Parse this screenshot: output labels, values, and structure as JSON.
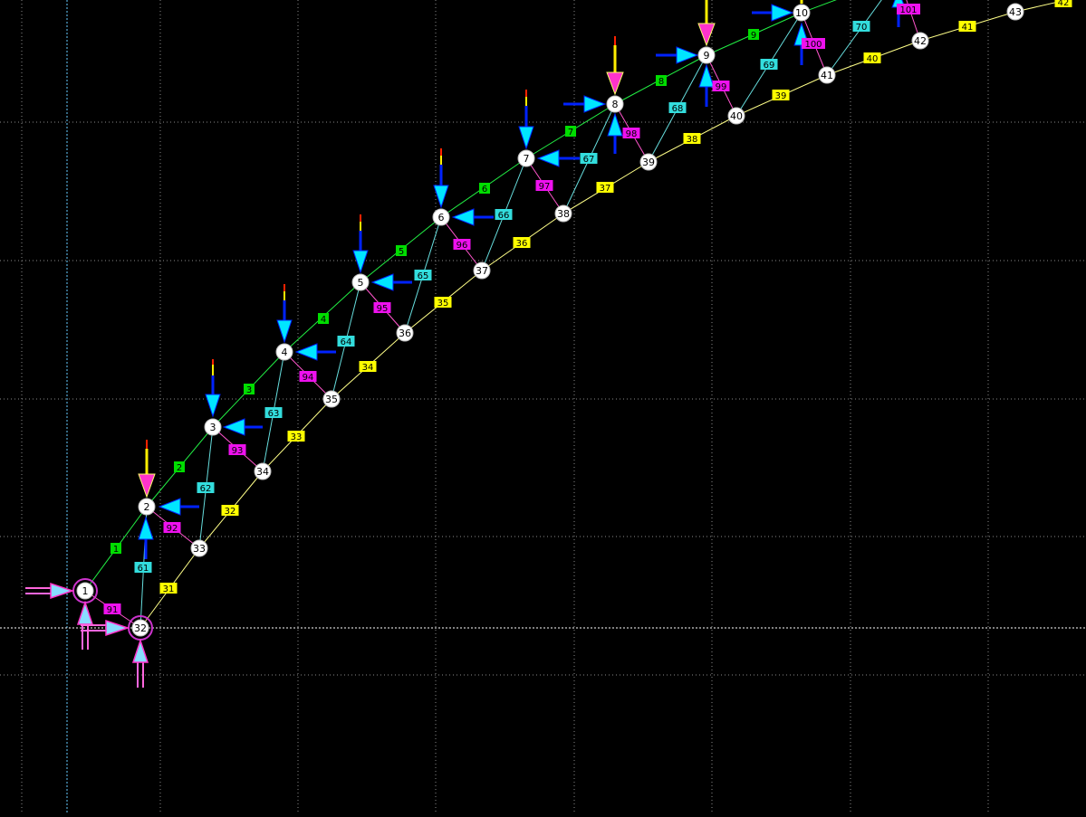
{
  "colors": {
    "background": "#000000",
    "grid": "#9a9a9a",
    "axis_dotted": "#ffffff",
    "axis_dashed_v": "#66ccff",
    "top_chord": "#00ff33",
    "bottom_chord": "#ffff66",
    "web_even": "#66e0e0",
    "web_odd": "#ff66cc",
    "node_fill": "#ffffff",
    "node_text": "#000000",
    "support_ring": "#cc33cc",
    "load_arrow": "#00e5ff",
    "load_shaft": "#0022ff",
    "load_magenta": "#ff33cc",
    "label_green": "#00dd00",
    "label_yellow": "#ffff00",
    "label_cyan": "#33dddd",
    "label_magenta": "#ee11ee"
  },
  "nodes": [
    {
      "id": "1"
    },
    {
      "id": "2"
    },
    {
      "id": "3"
    },
    {
      "id": "4"
    },
    {
      "id": "5"
    },
    {
      "id": "6"
    },
    {
      "id": "7"
    },
    {
      "id": "8"
    },
    {
      "id": "9"
    },
    {
      "id": "10"
    },
    {
      "id": "32"
    },
    {
      "id": "33"
    },
    {
      "id": "34"
    },
    {
      "id": "35"
    },
    {
      "id": "36"
    },
    {
      "id": "37"
    },
    {
      "id": "38"
    },
    {
      "id": "39"
    },
    {
      "id": "40"
    },
    {
      "id": "41"
    },
    {
      "id": "42"
    },
    {
      "id": "43"
    }
  ],
  "top_members": [
    "1",
    "2",
    "3",
    "4",
    "5",
    "6",
    "7",
    "8",
    "9"
  ],
  "bottom_members": [
    "31",
    "32",
    "33",
    "34",
    "35",
    "36",
    "37",
    "38",
    "39",
    "40",
    "41",
    "42"
  ],
  "web_members_cyan": [
    "61",
    "62",
    "63",
    "64",
    "65",
    "66",
    "67",
    "68",
    "69",
    "70"
  ],
  "web_members_magenta": [
    "91",
    "92",
    "93",
    "94",
    "95",
    "96",
    "97",
    "98",
    "99",
    "100",
    "101"
  ]
}
